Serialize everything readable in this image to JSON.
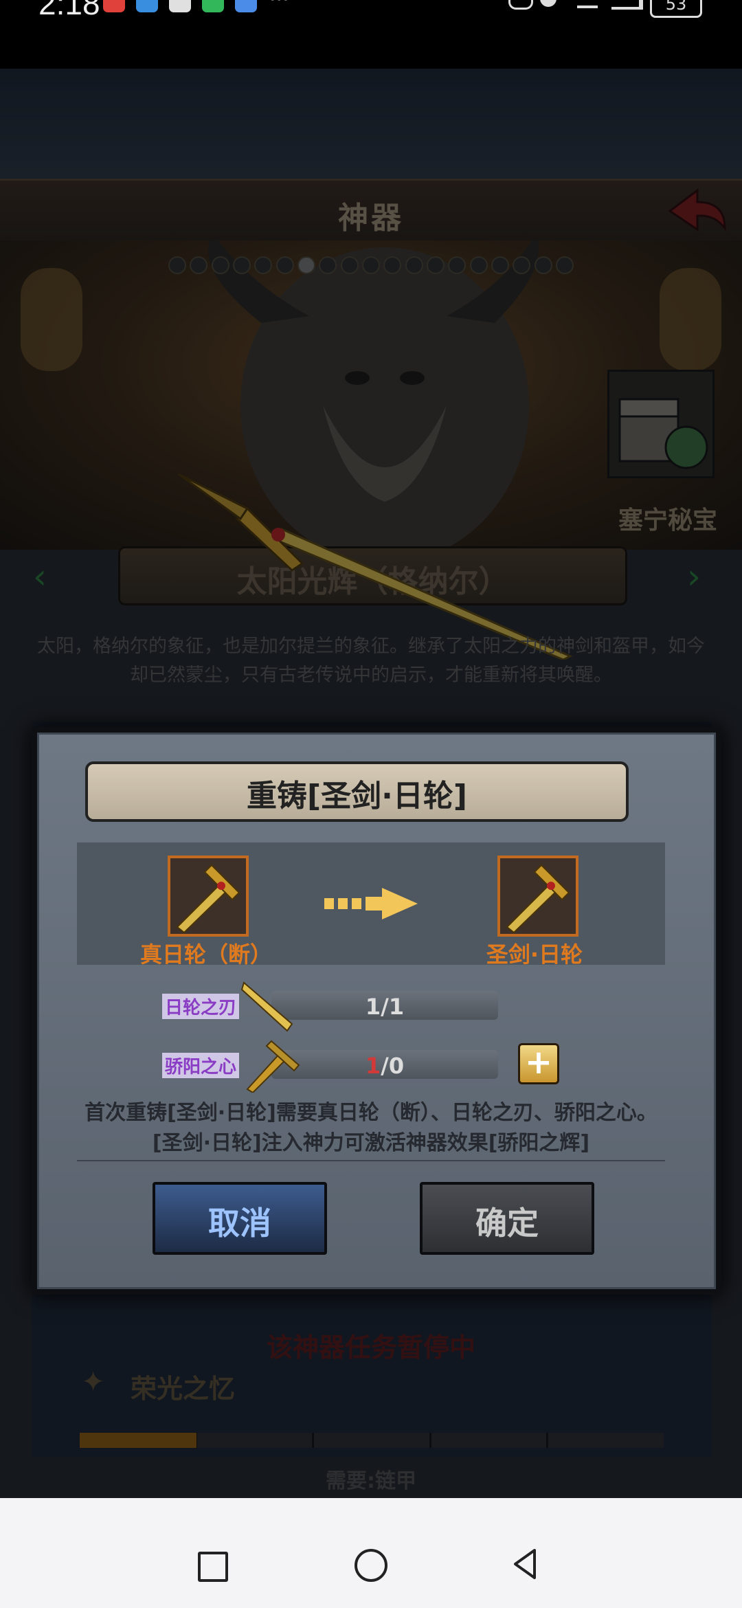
{
  "status_bar": {
    "time": "2:18",
    "battery": "53"
  },
  "header": {
    "title": "神器"
  },
  "artifact": {
    "chest_label": "塞宁秘宝",
    "name": "太阳光辉（格纳尔）",
    "description_line1": "太阳，格纳尔的象征，也是加尔提兰的象征。继承了太阳之力的神剑和盔甲，如今",
    "description_line2": "却已然蒙尘，只有古老传说中的启示，才能重新将其唤醒。",
    "page_count": 19,
    "current_page": 6
  },
  "dialog": {
    "title": "重铸[圣剑·日轮]",
    "from_item": "真日轮（断）",
    "to_item": "圣剑·日轮",
    "materials": [
      {
        "name": "日轮之刃",
        "have": "1",
        "separator": "/",
        "need": "1"
      },
      {
        "name": "骄阳之心",
        "have": "1",
        "separator": "/",
        "need": "0"
      }
    ],
    "plus_label": "+",
    "note_line1": "首次重铸[圣剑·日轮]需要真日轮（断）、日轮之刃、骄阳之心。",
    "note_line2": "[圣剑·日轮]注入神力可激活神器效果[骄阳之辉]",
    "cancel_label": "取消",
    "confirm_label": "确定"
  },
  "background": {
    "task_paused": "该神器任务暂停中",
    "memory_label": "荣光之忆",
    "requirement": "需要:链甲",
    "progress_fraction": 0.2
  },
  "colors": {
    "accent_orange": "#e07a1e",
    "purple_label": "#8a3cc4",
    "red_count": "#d23a3a"
  }
}
